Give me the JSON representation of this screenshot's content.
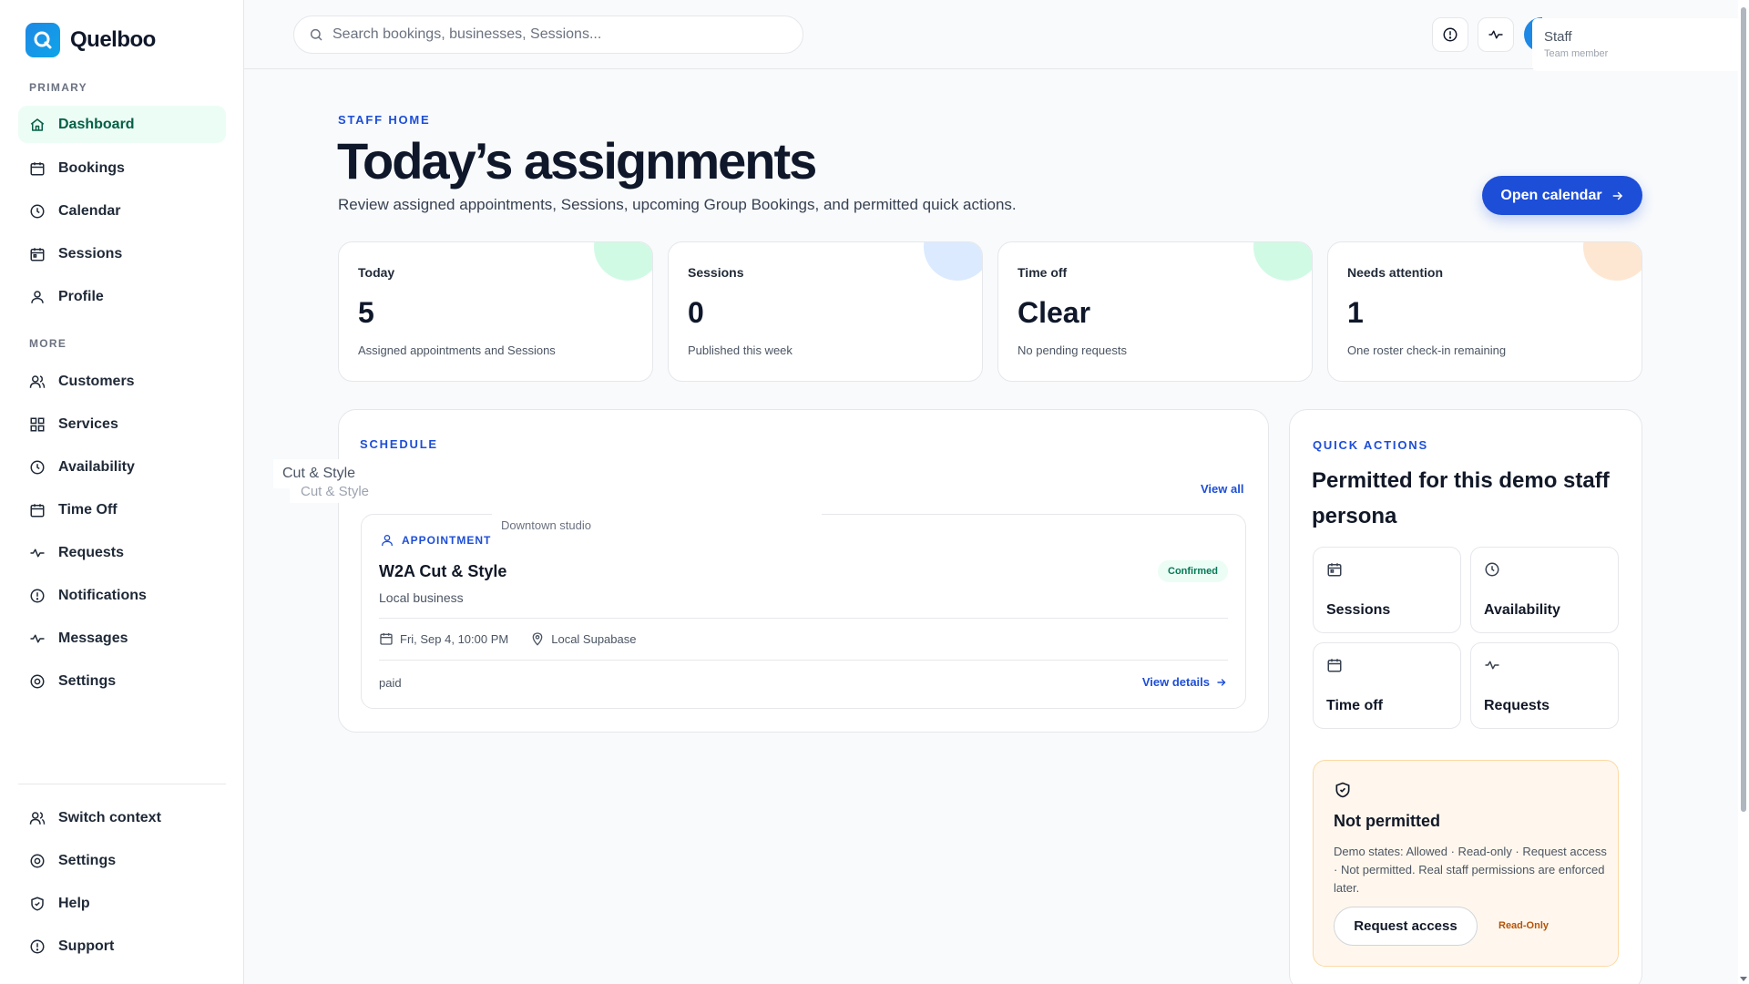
{
  "brand": {
    "name": "Quelboo"
  },
  "sidebar": {
    "primary_label": "PRIMARY",
    "primary_items": [
      {
        "label": "Dashboard",
        "icon": "home-icon",
        "active": true
      },
      {
        "label": "Bookings",
        "icon": "calendar-icon"
      },
      {
        "label": "Calendar",
        "icon": "clock-icon"
      },
      {
        "label": "Sessions",
        "icon": "calendar-grid-icon"
      },
      {
        "label": "Profile",
        "icon": "user-icon"
      }
    ],
    "more_label": "MORE",
    "more_items": [
      {
        "label": "Customers",
        "icon": "users-icon"
      },
      {
        "label": "Services",
        "icon": "grid-icon"
      },
      {
        "label": "Availability",
        "icon": "clock-icon"
      },
      {
        "label": "Time Off",
        "icon": "calendar-icon"
      },
      {
        "label": "Requests",
        "icon": "activity-icon"
      },
      {
        "label": "Notifications",
        "icon": "alert-circle-icon"
      },
      {
        "label": "Messages",
        "icon": "activity-icon"
      },
      {
        "label": "Settings",
        "icon": "gear-icon"
      }
    ],
    "footer_items": [
      {
        "label": "Switch context",
        "icon": "users-icon"
      },
      {
        "label": "Settings",
        "icon": "gear-icon"
      },
      {
        "label": "Help",
        "icon": "shield-icon"
      },
      {
        "label": "Support",
        "icon": "alert-circle-icon"
      }
    ]
  },
  "topbar": {
    "search_placeholder": "Search bookings, businesses, Sessions...",
    "profile_name": "Staff",
    "profile_role": "Team member"
  },
  "page": {
    "eyebrow": "STAFF HOME",
    "title": "Today’s assignments",
    "subtitle": "Review assigned appointments, Sessions, upcoming Group Bookings, and permitted quick actions.",
    "cta_label": "Open calendar"
  },
  "stats": [
    {
      "label": "Today",
      "value": "5",
      "caption": "Assigned appointments and Sessions",
      "accent": "#d1fae5"
    },
    {
      "label": "Sessions",
      "value": "0",
      "caption": "Published this week",
      "accent": "#dbeafe"
    },
    {
      "label": "Time off",
      "value": "Clear",
      "caption": "No pending requests",
      "accent": "#d1fae5"
    },
    {
      "label": "Needs attention",
      "value": "1",
      "caption": "One roster check-in remaining",
      "accent": "#fde7d3"
    }
  ],
  "schedule": {
    "eyebrow": "SCHEDULE",
    "view_all": "View all",
    "booking": {
      "type": "APPOINTMENT",
      "title": "W2A Cut & Style",
      "subtitle": "Local business",
      "status": "Confirmed",
      "datetime": "Fri, Sep 4, 10:00 PM",
      "location": "Local Supabase",
      "payment": "paid",
      "details_label": "View details"
    }
  },
  "overlays": {
    "tooltip_primary": "Cut & Style",
    "tooltip_shadow": "Cut & Style",
    "tooltip_location": "Downtown studio"
  },
  "quick_actions": {
    "eyebrow": "QUICK ACTIONS",
    "title": "Permitted for this demo staff persona",
    "tiles": [
      {
        "label": "Sessions",
        "icon": "calendar-grid-icon"
      },
      {
        "label": "Availability",
        "icon": "clock-icon"
      },
      {
        "label": "Time off",
        "icon": "calendar-icon"
      },
      {
        "label": "Requests",
        "icon": "activity-icon"
      }
    ],
    "notice": {
      "title": "Not permitted",
      "body": "Demo states: Allowed · Read-only · Request access · Not permitted. Real staff permissions are enforced later.",
      "button": "Request access",
      "badge": "Read-Only"
    }
  },
  "colors": {
    "accent": "#1d4ed8",
    "active_nav_bg": "#ecfdf5",
    "success": "#047857",
    "warning_bg": "#fff7ed"
  }
}
